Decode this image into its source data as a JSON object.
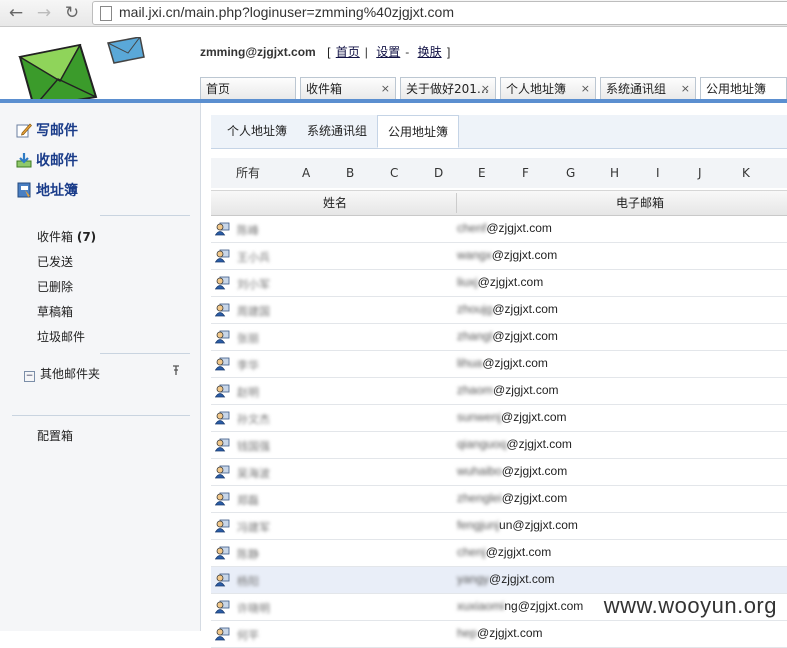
{
  "browser": {
    "back": "←",
    "forward": "→",
    "reload": "↻",
    "url": "mail.jxi.cn/main.php?loginuser=zmming%40zjgjxt.com"
  },
  "header": {
    "user": "zmming@zjgjxt.com",
    "open_bracket": "[",
    "close_bracket": "]",
    "links": {
      "home": "首页",
      "settings": "设置",
      "skin": "换肤"
    },
    "sep1": "|",
    "sep2": "-",
    "tabs": [
      {
        "label": "首页",
        "closable": false
      },
      {
        "label": "收件箱",
        "closable": true
      },
      {
        "label": "关于做好201…",
        "closable": true
      },
      {
        "label": "个人地址簿",
        "closable": true
      },
      {
        "label": "系统通讯组",
        "closable": true
      },
      {
        "label": "公用地址簿",
        "closable": false
      }
    ],
    "close_glyph": "×"
  },
  "sidebar": {
    "compose": "写邮件",
    "receive": "收邮件",
    "addressbook": "地址簿",
    "folders": [
      {
        "label": "收件箱",
        "count": "(7)"
      },
      {
        "label": "已发送"
      },
      {
        "label": "已删除"
      },
      {
        "label": "草稿箱"
      },
      {
        "label": "垃圾邮件"
      }
    ],
    "other_folders": "其他邮件夹",
    "other_toggle": "−",
    "config": "配置箱"
  },
  "main": {
    "subtabs": [
      "个人地址簿",
      "系统通讯组",
      "公用地址簿"
    ],
    "alpha": [
      "所有",
      "A",
      "B",
      "C",
      "D",
      "E",
      "F",
      "G",
      "H",
      "I",
      "J",
      "K"
    ],
    "col_name": "姓名",
    "col_email": "电子邮箱",
    "rows": [
      {
        "name": "陈峰",
        "mask": "chenf",
        "rest": "@zjgjxt.com"
      },
      {
        "name": "王小兵",
        "mask": "wangx",
        "rest": "@zjgjxt.com"
      },
      {
        "name": "刘小军",
        "mask": "liuxj",
        "rest": "@zjgjxt.com"
      },
      {
        "name": "周建国",
        "mask": "zhoujg",
        "rest": "@zjgjxt.com"
      },
      {
        "name": "张丽",
        "mask": "zhangl",
        "rest": "@zjgjxt.com"
      },
      {
        "name": "李华",
        "mask": "lihua",
        "rest": "@zjgjxt.com"
      },
      {
        "name": "赵明",
        "mask": "zhaom",
        "rest": "@zjgjxt.com"
      },
      {
        "name": "孙文杰",
        "mask": "sunwenj",
        "rest": "@zjgjxt.com"
      },
      {
        "name": "钱国强",
        "mask": "qianguoq",
        "rest": "@zjgjxt.com"
      },
      {
        "name": "吴海波",
        "mask": "wuhaibo",
        "rest": "@zjgjxt.com"
      },
      {
        "name": "郑磊",
        "mask": "zhenglei",
        "rest": "@zjgjxt.com"
      },
      {
        "name": "冯建军",
        "mask": "fengjunj",
        "rest": "un@zjgjxt.com"
      },
      {
        "name": "陈静",
        "mask": "chenj",
        "rest": "@zjgjxt.com"
      },
      {
        "name": "杨阳",
        "mask": "yangy",
        "rest": "@zjgjxt.com"
      },
      {
        "name": "许晓明",
        "mask": "xuxiaomi",
        "rest": "ng@zjgjxt.com"
      },
      {
        "name": "何平",
        "mask": "hep",
        "rest": "@zjgjxt.com"
      }
    ]
  },
  "watermark": "www.wooyun.org",
  "colors": {
    "accent": "#5b8fd0",
    "link": "#1a3c8a"
  }
}
